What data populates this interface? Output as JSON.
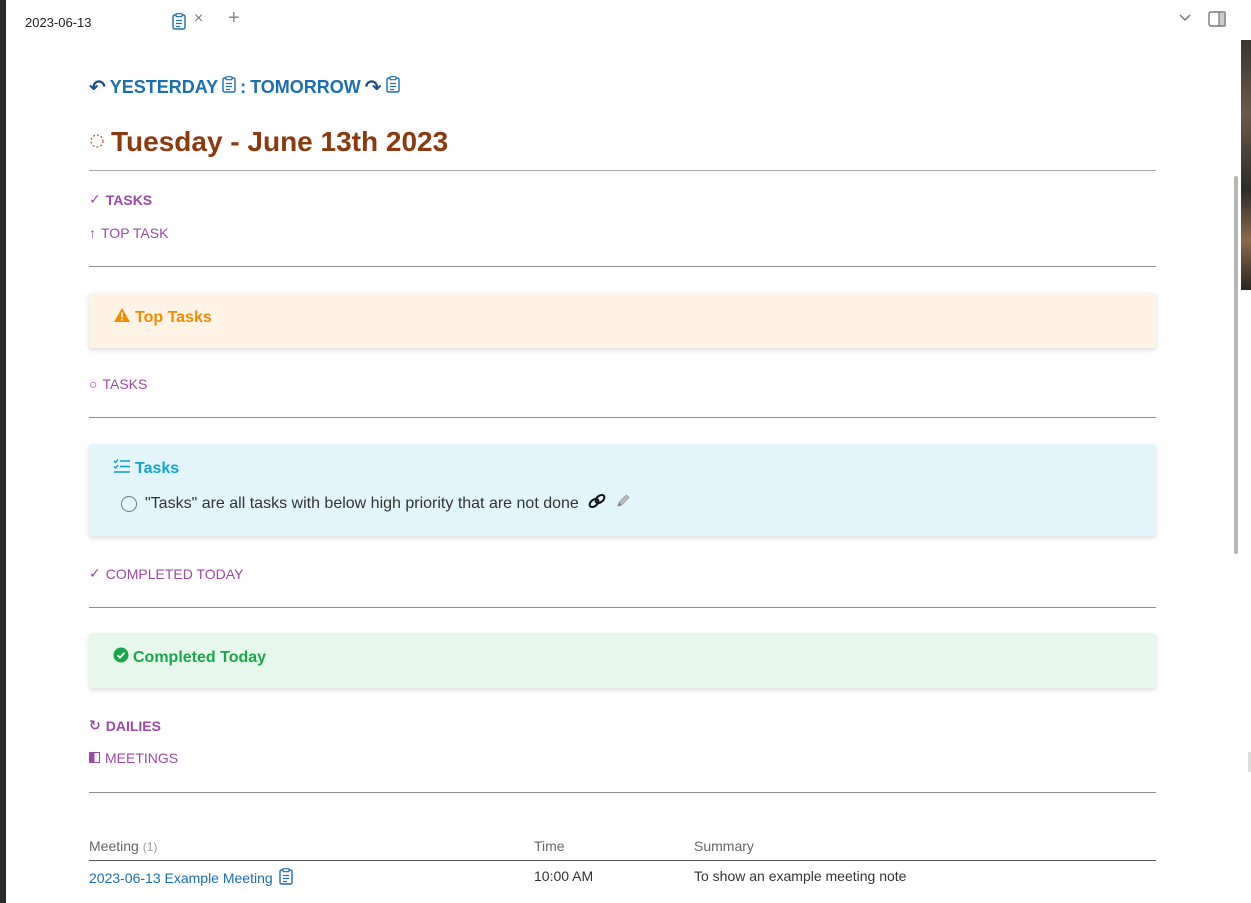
{
  "tab": {
    "title": "2023-06-13",
    "close": "×",
    "add": "+"
  },
  "nav": {
    "yesterday": "YESTERDAY",
    "separator": ":",
    "tomorrow": "TOMORROW"
  },
  "page_title": "Tuesday - June 13th 2023",
  "sections": {
    "tasks_heading": "TASKS",
    "top_task_heading": "TOP TASK",
    "tasks_list_heading": "TASKS",
    "completed_heading": "COMPLETED TODAY",
    "dailies_heading": "DAILIES",
    "meetings_heading": "MEETINGS"
  },
  "callouts": {
    "top_tasks": {
      "title": "Top Tasks",
      "color": "#f08c00"
    },
    "tasks": {
      "title": "Tasks",
      "color": "#13a3c9",
      "items": [
        {
          "text": "\"Tasks\" are all tasks with below high priority that are not done"
        }
      ]
    },
    "completed_today": {
      "title": "Completed Today",
      "color": "#1aa64a"
    }
  },
  "meetings_table": {
    "columns": {
      "meeting": "Meeting",
      "meeting_count": "(1)",
      "time": "Time",
      "summary": "Summary"
    },
    "rows": [
      {
        "meeting": "2023-06-13 Example Meeting",
        "time": "10:00 AM",
        "summary": "To show an example meeting note"
      }
    ]
  }
}
